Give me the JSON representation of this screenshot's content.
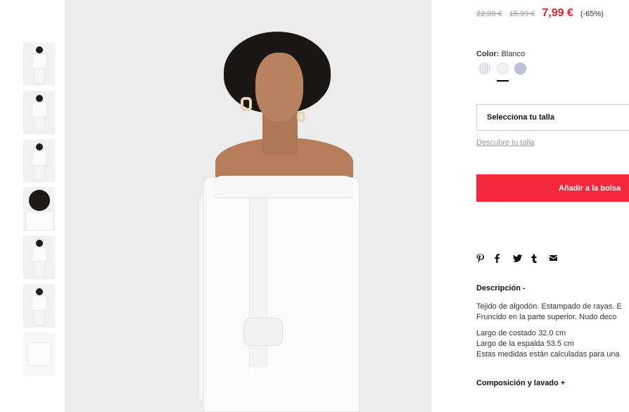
{
  "thumbnails": [
    {
      "label": "thumbnail-1"
    },
    {
      "label": "thumbnail-2"
    },
    {
      "label": "thumbnail-3"
    },
    {
      "label": "thumbnail-4"
    },
    {
      "label": "thumbnail-5"
    },
    {
      "label": "thumbnail-6"
    },
    {
      "label": "thumbnail-7"
    }
  ],
  "price": {
    "original_1": "22,99 €",
    "original_2": "15,99 €",
    "current": "7,99 €",
    "discount": "(-65%)",
    "current_color": "#e0202f"
  },
  "color": {
    "label": "Color:",
    "value": "Blanco",
    "swatches": [
      "stripe-swatch",
      "white-swatch",
      "blue-swatch"
    ],
    "selected_index": 1
  },
  "size": {
    "select_label": "Selecciona tu talla",
    "guide_link": "Descubre tu talla"
  },
  "cart": {
    "add_label": "Añadir a la bolsa",
    "button_color": "#f3283a"
  },
  "share": {
    "icons": [
      "pinterest-icon",
      "facebook-icon",
      "twitter-icon",
      "tumblr-icon",
      "email-icon"
    ]
  },
  "description": {
    "title": "Descripción -",
    "paragraph1_line1": "Tejido de algodón. Estampado de rayas. E",
    "paragraph1_line2": "Fruncido en la parte superior. Nudo deco",
    "paragraph2_line1": "Largo de costado 32.0 cm",
    "paragraph2_line2": "Largo de la espalda 53.5 cm",
    "paragraph2_line3": "Estas medidas están calculadas para una"
  },
  "composition": {
    "title": "Composición y lavado +"
  }
}
